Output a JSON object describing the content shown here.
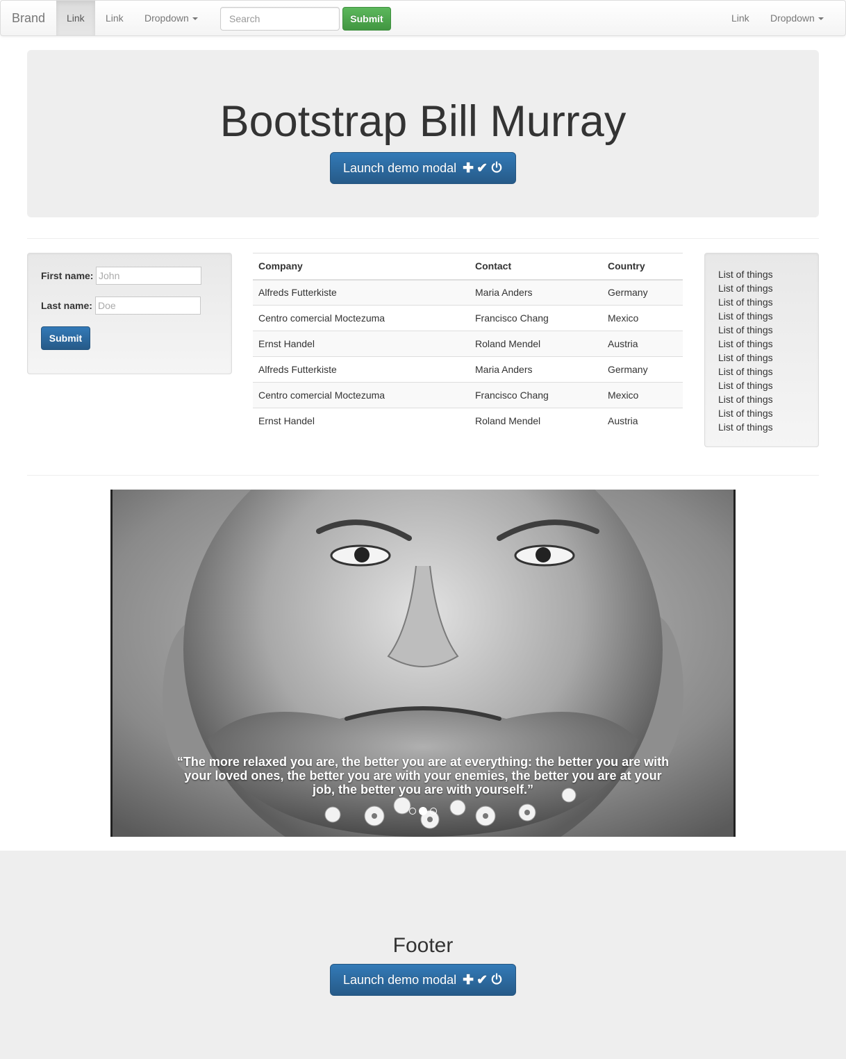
{
  "navbar": {
    "brand": "Brand",
    "links_left": [
      "Link",
      "Link"
    ],
    "dropdown_left": "Dropdown",
    "search_placeholder": "Search",
    "submit_label": "Submit",
    "link_right": "Link",
    "dropdown_right": "Dropdown"
  },
  "jumbotron": {
    "title": "Bootstrap Bill Murray",
    "button_label": "Launch demo modal"
  },
  "form": {
    "first_name_label": "First name:",
    "first_name_placeholder": "John",
    "last_name_label": "Last name:",
    "last_name_placeholder": "Doe",
    "submit_label": "Submit"
  },
  "table": {
    "headers": [
      "Company",
      "Contact",
      "Country"
    ],
    "rows": [
      [
        "Alfreds Futterkiste",
        "Maria Anders",
        "Germany"
      ],
      [
        "Centro comercial Moctezuma",
        "Francisco Chang",
        "Mexico"
      ],
      [
        "Ernst Handel",
        "Roland Mendel",
        "Austria"
      ],
      [
        "Alfreds Futterkiste",
        "Maria Anders",
        "Germany"
      ],
      [
        "Centro comercial Moctezuma",
        "Francisco Chang",
        "Mexico"
      ],
      [
        "Ernst Handel",
        "Roland Mendel",
        "Austria"
      ]
    ]
  },
  "list": {
    "items": [
      "List of things",
      "List of things",
      "List of things",
      "List of things",
      "List of things",
      "List of things",
      "List of things",
      "List of things",
      "List of things",
      "List of things",
      "List of things",
      "List of things"
    ]
  },
  "carousel": {
    "caption": "“The more relaxed you are, the better you are at everything: the better you are with your loved ones, the better you are with your enemies, the better you are at your job, the better you are with yourself.”",
    "slide_count": 3,
    "active_slide": 2
  },
  "footer": {
    "title": "Footer",
    "button_label": "Launch demo modal"
  },
  "colors": {
    "primary": "#337ab7",
    "success": "#5cb85c",
    "jumbotron_bg": "#eeeeee"
  }
}
